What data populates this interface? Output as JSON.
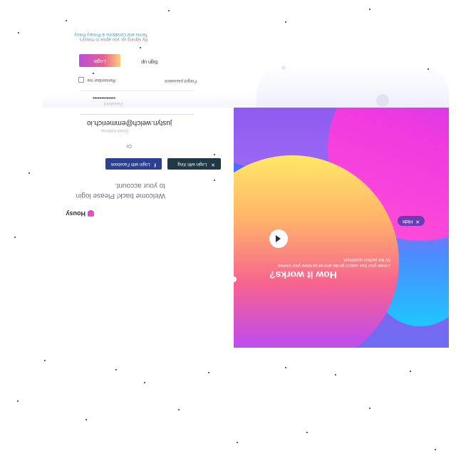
{
  "brand": {
    "name": "Housy"
  },
  "welcome": {
    "line1": "Welcome back! Please login",
    "line2": "to your account."
  },
  "social": {
    "facebook_label": "Login with Facebook",
    "xing_label": "Login with Xing",
    "or_label": "Or"
  },
  "form": {
    "email_label": "Email Address",
    "email_value": "justyn.welch@emmerich.io",
    "password_label": "Password",
    "password_value": "•••••••••••••",
    "remember_label": "Remember me",
    "forgot_label": "Forgot password",
    "login_label": "Login",
    "signup_label": "Sign up"
  },
  "terms": {
    "prefix": "By signing up, you agree to Housy's",
    "link": "Terms and Conditions & Privacy Policy"
  },
  "hero": {
    "title": "How it works?",
    "subtitle_line1": "Create your free search profile and let us know your wishes",
    "subtitle_line2": "for the perfect apartment.",
    "hide_label": "Hide"
  },
  "colors": {
    "login_gradient_start": "#b84fd8",
    "login_gradient_end": "#ffd17a",
    "facebook": "#2d3f8f",
    "xing": "#1f3a44",
    "terms_link": "#2fa4c8"
  },
  "icons": {
    "play": "play-icon",
    "close": "close-icon",
    "facebook": "facebook-icon",
    "xing": "xing-icon",
    "logo": "house-logo-icon"
  }
}
